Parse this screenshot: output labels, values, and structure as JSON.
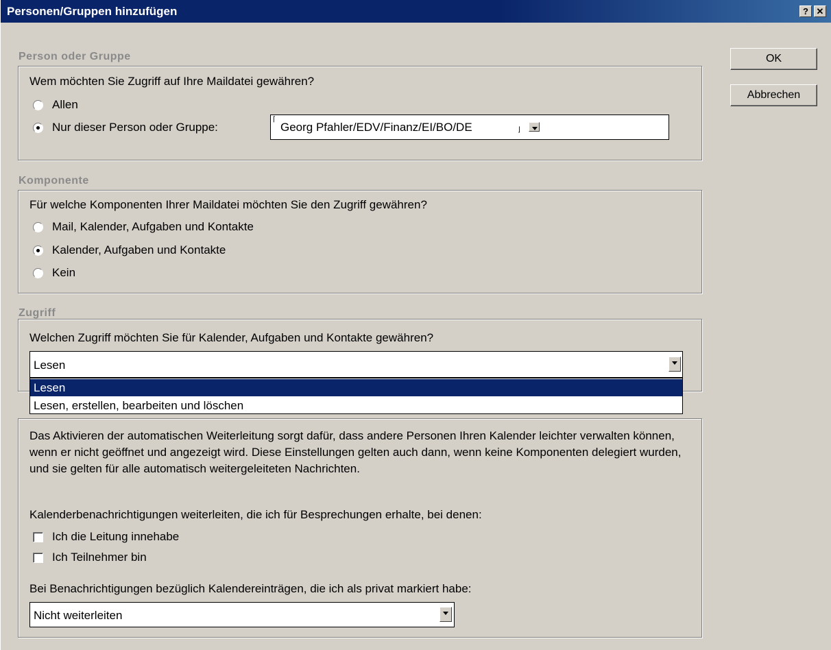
{
  "window": {
    "title": "Personen/Gruppen hinzufügen",
    "help_label": "?",
    "close_label": "✕"
  },
  "buttons": {
    "ok": "OK",
    "cancel": "Abbrechen"
  },
  "person_group": {
    "label": "Person oder Gruppe",
    "question": "Wem möchten Sie Zugriff auf Ihre Maildatei gewähren?",
    "option_all": "Allen",
    "option_person": "Nur dieser Person oder Gruppe:",
    "person_value": "Georg Pfahler/EDV/Finanz/EI/BO/DE",
    "selected": "person"
  },
  "component": {
    "label": "Komponente",
    "question": "Für welche Komponenten Ihrer Maildatei möchten Sie den Zugriff gewähren?",
    "options": [
      "Mail, Kalender, Aufgaben und Kontakte",
      "Kalender, Aufgaben und Kontakte",
      "Kein"
    ],
    "selected_index": 1
  },
  "access": {
    "label": "Zugriff",
    "question": "Welchen Zugriff möchten Sie für Kalender, Aufgaben und Kontakte gewähren?",
    "value": "Lesen",
    "options": [
      "Lesen",
      "Lesen, erstellen, bearbeiten und löschen"
    ],
    "highlighted_index": 0
  },
  "forwarding": {
    "paragraph": "Das Aktivieren der automatischen Weiterleitung sorgt dafür, dass andere Personen Ihren Kalender leichter verwalten können, wenn er nicht geöffnet und angezeigt wird. Diese Einstellungen gelten auch dann, wenn keine Komponenten delegiert wurden, und sie gelten für alle automatisch weitergeleiteten Nachrichten.",
    "meeting_question": "Kalenderbenachrichtigungen weiterleiten, die ich für Besprechungen erhalte, bei denen:",
    "check_chair": "Ich die Leitung innehabe",
    "check_participant": "Ich Teilnehmer bin",
    "private_question": "Bei Benachrichtigungen bezüglich Kalendereinträgen, die ich als privat markiert habe:",
    "private_value": "Nicht weiterleiten"
  },
  "colors": {
    "titlebar": "#0a246a",
    "face": "#d4d0c8",
    "selection": "#0a246a"
  }
}
